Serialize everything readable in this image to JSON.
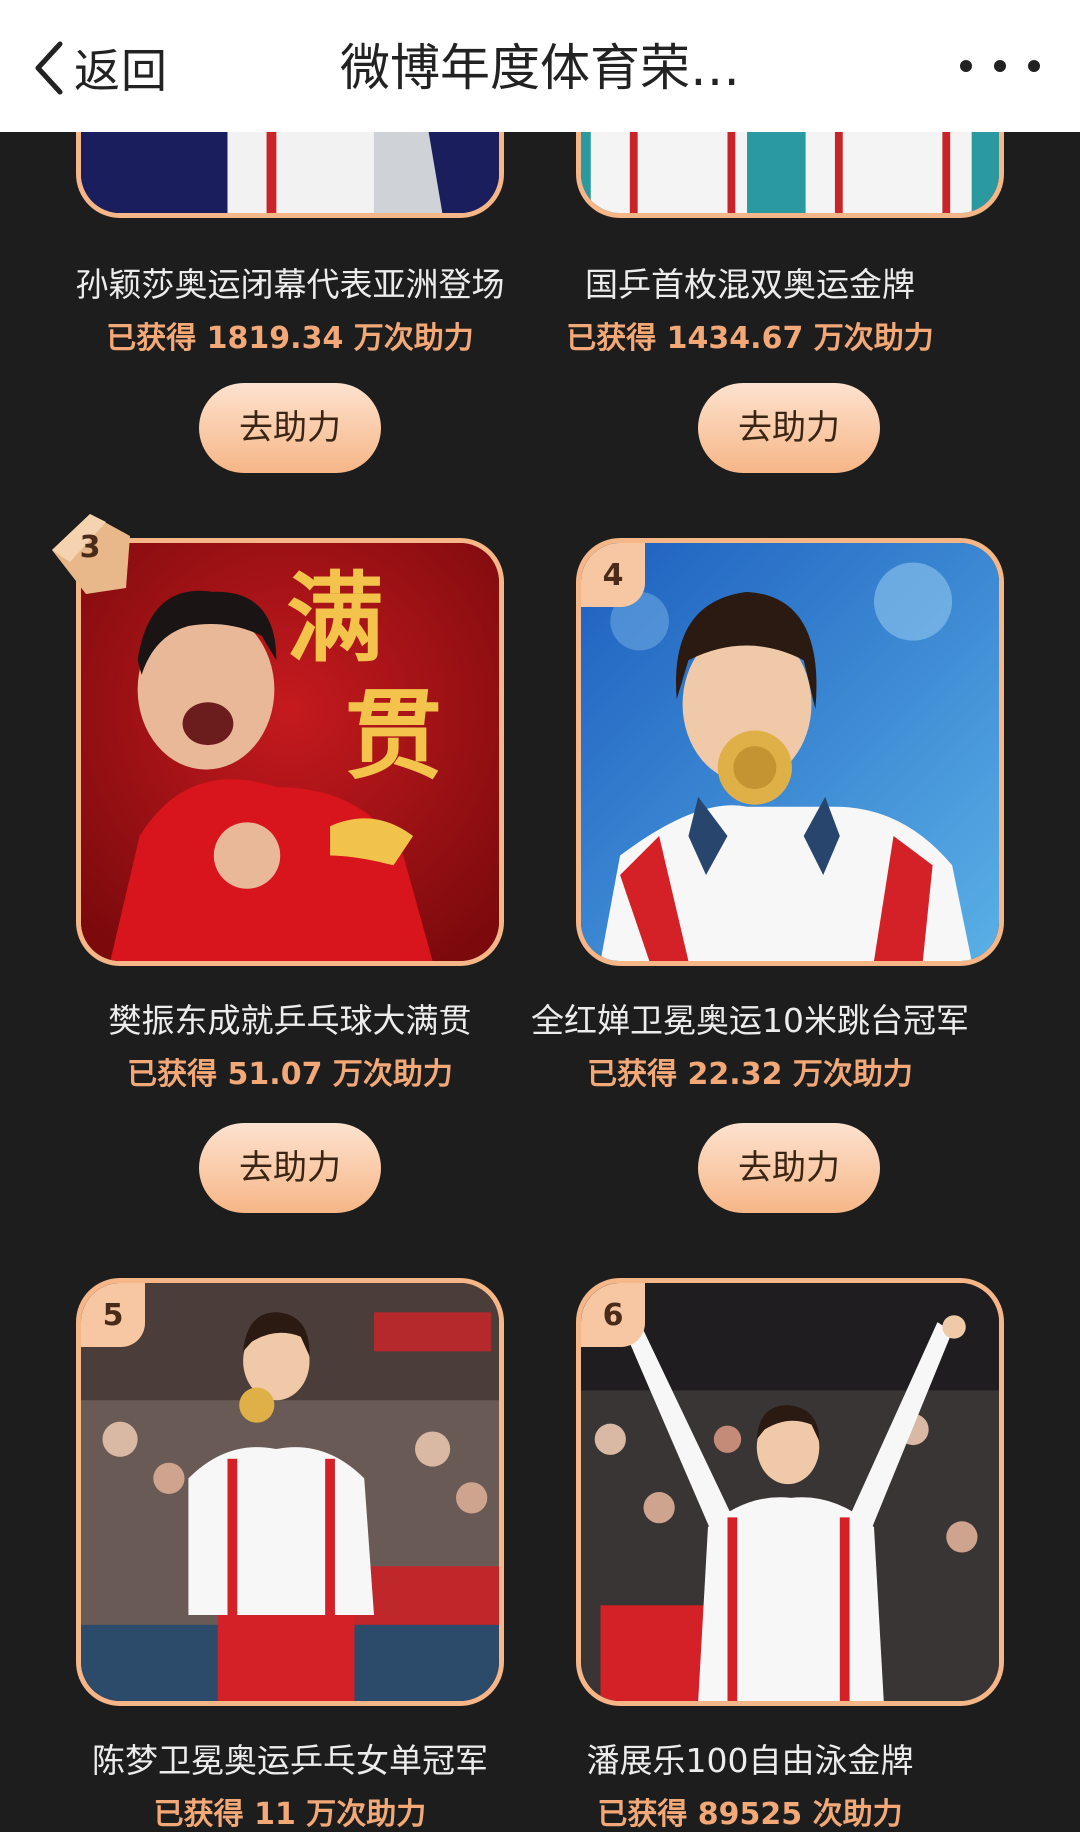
{
  "navbar": {
    "back_label": "返回",
    "title": "微博年度体育荣…"
  },
  "buttons": {
    "help_label": "去助力"
  },
  "cards": [
    {
      "title": "孙颖莎奥运闭幕代表亚洲登场",
      "count": "已获得 1819.34 万次助力"
    },
    {
      "title": "国乒首枚混双奥运金牌",
      "count": "已获得 1434.67 万次助力"
    },
    {
      "rank": "3",
      "title": "樊振东成就乒乓球大满贯",
      "count": "已获得 51.07 万次助力",
      "photo_text_1": "满",
      "photo_text_2": "贯"
    },
    {
      "rank": "4",
      "title": "全红婵卫冕奥运10米跳台冠军",
      "count": "已获得 22.32 万次助力"
    },
    {
      "rank": "5",
      "title": "陈梦卫冕奥运乒乓女单冠军",
      "count": "已获得 11 万次助力"
    },
    {
      "rank": "6",
      "title": "潘展乐100自由泳金牌",
      "count": "已获得 89525 次助力"
    }
  ],
  "colors": {
    "background": "#1d1d1d",
    "accent": "#f6b687",
    "count_text": "#f2a877"
  },
  "icons": {
    "back": "chevron-left-icon",
    "more": "more-dots-icon",
    "rank_ribbon": "ribbon-icon"
  }
}
